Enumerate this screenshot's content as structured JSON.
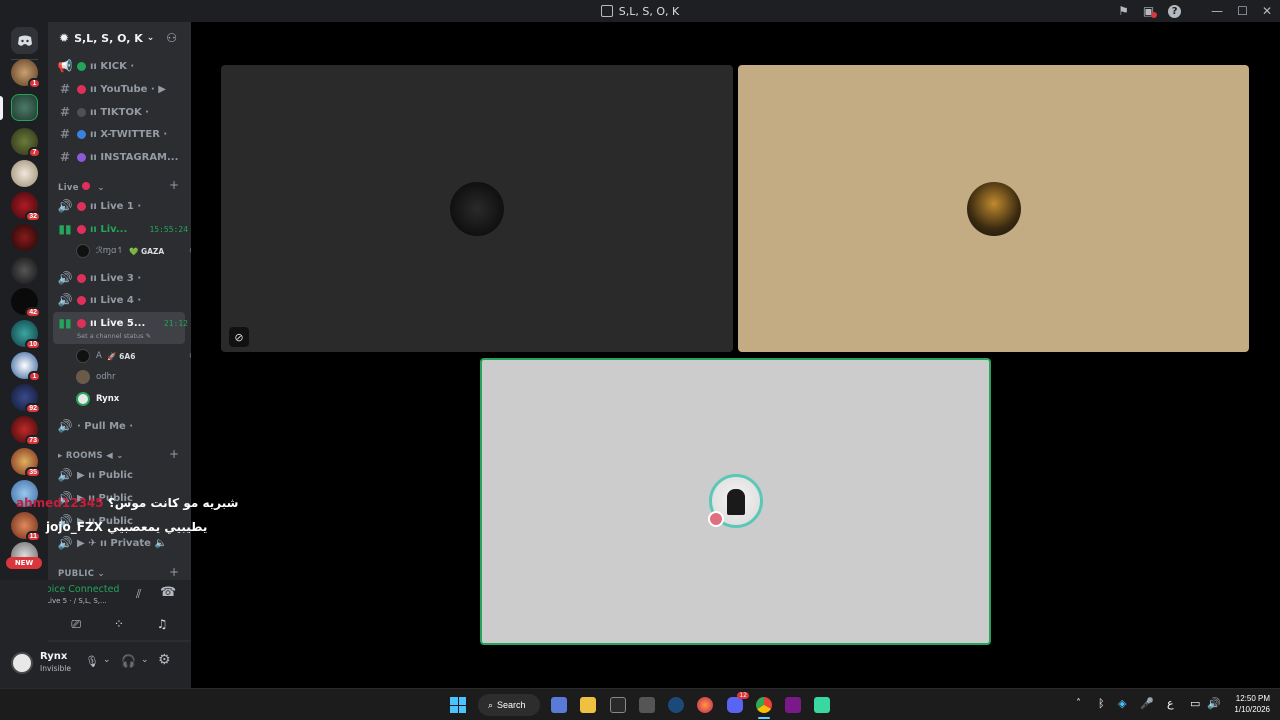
{
  "window": {
    "title": "S,L, S, O, K"
  },
  "server_badges": [
    "1",
    "7",
    "32",
    "42",
    "10",
    "1",
    "92",
    "73",
    "35",
    "11"
  ],
  "new_badge": "NEW",
  "guild": {
    "name": "S,L, S, O, K"
  },
  "channels": {
    "kick": "ıı KICK ·",
    "youtube": "ıı YouTube · ▶",
    "tiktok": "ıı TIKTOK ·",
    "x_twitter": "ıı X-TWITTER ·",
    "instagram": "ıı INSTAGRAM..."
  },
  "categories": {
    "live": "Live",
    "rooms": "ROOMS ◀",
    "public": "PUBLIC"
  },
  "voice_channels": {
    "live1": "ıı Live 1 ·",
    "live2": "ıı Liv...",
    "live2_time": "15:55:24",
    "live3": "ıı Live 3 ·",
    "live4": "ıı Live 4 ·",
    "live5": "ıı Live 5...",
    "live5_time": "21:12",
    "live5_status": "Set a channel status",
    "pullme": "· Pull Me ·",
    "room1": "▶ ıı Public",
    "room2": "▶ ıı Public",
    "room3": "▶ ıı Public",
    "room4": "▶ ✈ ıı Private"
  },
  "members": {
    "live2_user": "ℛɱɑ↿",
    "live2_tag": "💚 GAZA",
    "live5_user1": "A",
    "live5_user1_tag": "🚀 6A6",
    "live5_user2": "odhr",
    "live5_user3": "Rynx"
  },
  "voice": {
    "status": "Voice Connected",
    "location": "ıı Live 5 · / S,L, S,..."
  },
  "user": {
    "name": "Rynx",
    "status": "Invisible"
  },
  "overlay": {
    "line1_name": "ahmed12345",
    "line1_msg": "شبريه مو كانت موس؟",
    "line2_name": "jojo_FZX",
    "line2_msg": "يطيبيي يمعصبيي"
  },
  "taskbar": {
    "search": "Search",
    "time": "12:50 PM",
    "date": "1/10/2026",
    "lang": "ع",
    "discord_badge": "12"
  },
  "colors": {
    "accent_green": "#23a55a",
    "tile_tan": "#c3ab84",
    "tile_gray": "#cccccc",
    "tile_dark": "#2a2a2a"
  }
}
